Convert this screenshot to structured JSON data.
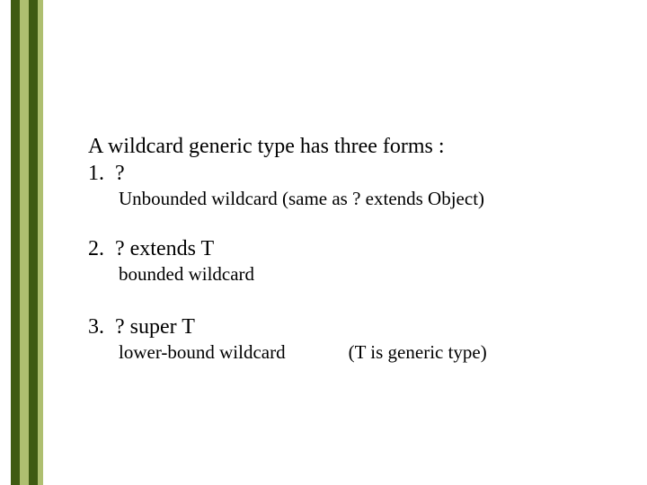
{
  "intro": "A wildcard generic type has three forms :",
  "items": [
    {
      "num": "1.",
      "title": "?",
      "sub": "Unbounded  wildcard  (same as ? extends Object)"
    },
    {
      "num": "2.",
      "title": "? extends T",
      "sub": "bounded wildcard"
    },
    {
      "num": "3.",
      "title": "? super T",
      "sub": "lower-bound wildcard",
      "note": "(T is generic type)"
    }
  ]
}
